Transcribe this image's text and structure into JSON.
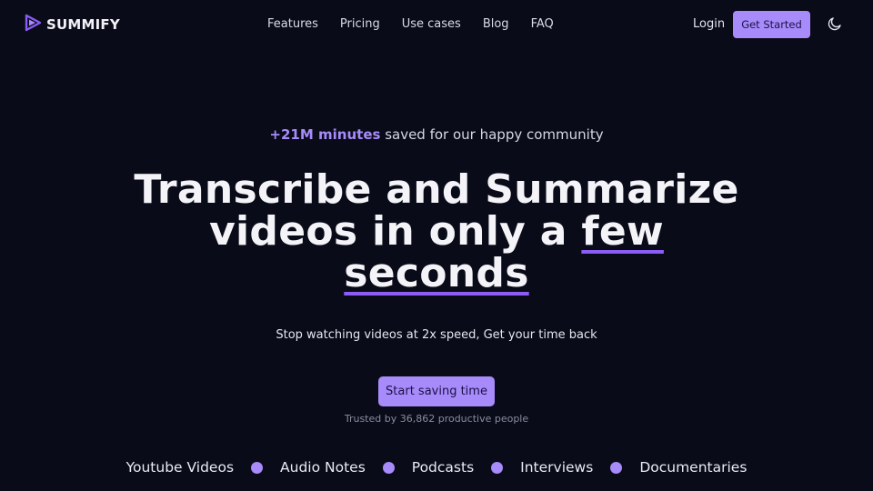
{
  "header": {
    "brand": "SUMMIFY",
    "nav": [
      "Features",
      "Pricing",
      "Use cases",
      "Blog",
      "FAQ"
    ],
    "login_label": "Login",
    "cta_label": "Get Started",
    "theme_icon": "moon-icon"
  },
  "hero": {
    "tagline_highlight": "+21M minutes",
    "tagline_rest": " saved for our happy community",
    "headline_line1": "Transcribe and Summarize",
    "headline_line2_pre": "videos in only a ",
    "headline_underline1": "few",
    "headline_underline2": "seconds",
    "subhead": "Stop watching videos at 2x speed, Get your time back",
    "cta_label": "Start saving time",
    "trusted": "Trusted by 36,862 productive people"
  },
  "use_cases": [
    "Youtube Videos",
    "Audio Notes",
    "Podcasts",
    "Interviews",
    "Documentaries"
  ],
  "colors": {
    "background": "#090b19",
    "accent": "#a78bfa",
    "underline": "#8b5cf6"
  }
}
